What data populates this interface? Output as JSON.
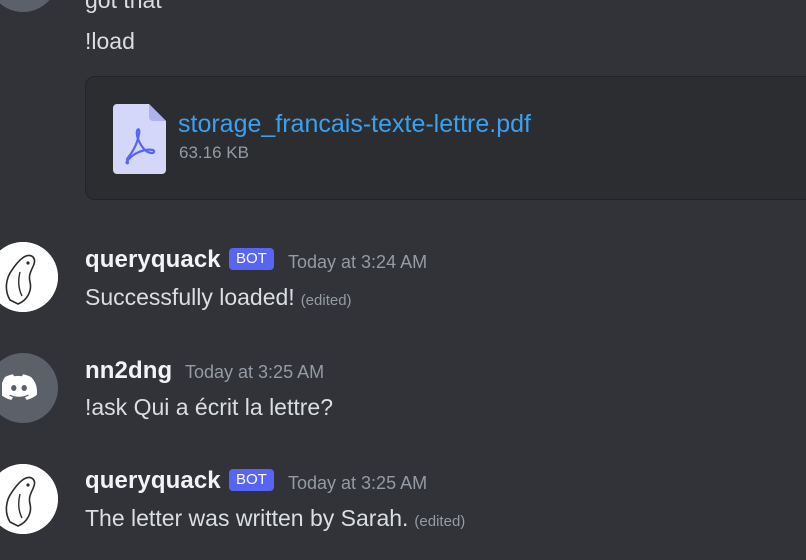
{
  "previous": {
    "partial_text": "got that",
    "command": "!load"
  },
  "attachment": {
    "file_name": "storage_francais-texte-lettre.pdf",
    "file_size": "63.16 KB",
    "icon": "pdf-file-icon"
  },
  "messages": [
    {
      "author": "queryquack",
      "badge": "BOT",
      "timestamp": "Today at 3:24 AM",
      "text": "Successfully loaded!",
      "edited": "(edited)",
      "avatar_icon": "duck-avatar"
    },
    {
      "author": "nn2dng",
      "badge": "",
      "timestamp": "Today at 3:25 AM",
      "text": "!ask Qui a écrit la lettre?",
      "edited": "",
      "avatar_icon": "discord-logo-avatar"
    },
    {
      "author": "queryquack",
      "badge": "BOT",
      "timestamp": "Today at 3:25 AM",
      "text": "The letter was written by Sarah.",
      "edited": "(edited)",
      "avatar_icon": "duck-avatar"
    }
  ],
  "colors": {
    "background": "#313338",
    "attachment_bg": "#2b2d31",
    "link": "#3ba1ee",
    "bot_badge": "#5865f2",
    "muted": "#949ba4",
    "text": "#dbdee1"
  }
}
